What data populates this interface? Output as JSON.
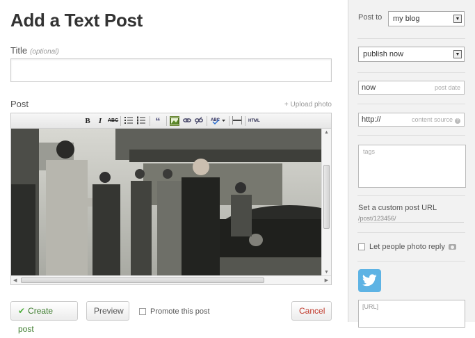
{
  "page": {
    "title": "Add a Text Post",
    "title_label": "Title",
    "title_optional": "(optional)",
    "post_label": "Post",
    "upload_photo": "+ Upload photo"
  },
  "toolbar": {
    "bold": "B",
    "italic": "I",
    "strike": "ABC",
    "quote": "“",
    "html": "HTML"
  },
  "actions": {
    "create": "Create post",
    "create_check": "✔",
    "preview": "Preview",
    "promote": "Promote this post",
    "cancel": "Cancel"
  },
  "sidebar": {
    "post_to_label": "Post to",
    "post_to_value": "my blog",
    "publish_value": "publish now",
    "date_value": "now",
    "date_hint": "post date",
    "source_value": "http://",
    "source_hint": "content source",
    "tags_placeholder": "tags",
    "custom_url_label": "Set a custom post URL",
    "custom_url_value": "/post/123456/",
    "photo_reply_label": "Let people photo reply",
    "twitter_url": "[URL]"
  },
  "colors": {
    "accent_green": "#4caf3a",
    "cancel_red": "#c0392b",
    "twitter_blue": "#5eb3e4"
  }
}
